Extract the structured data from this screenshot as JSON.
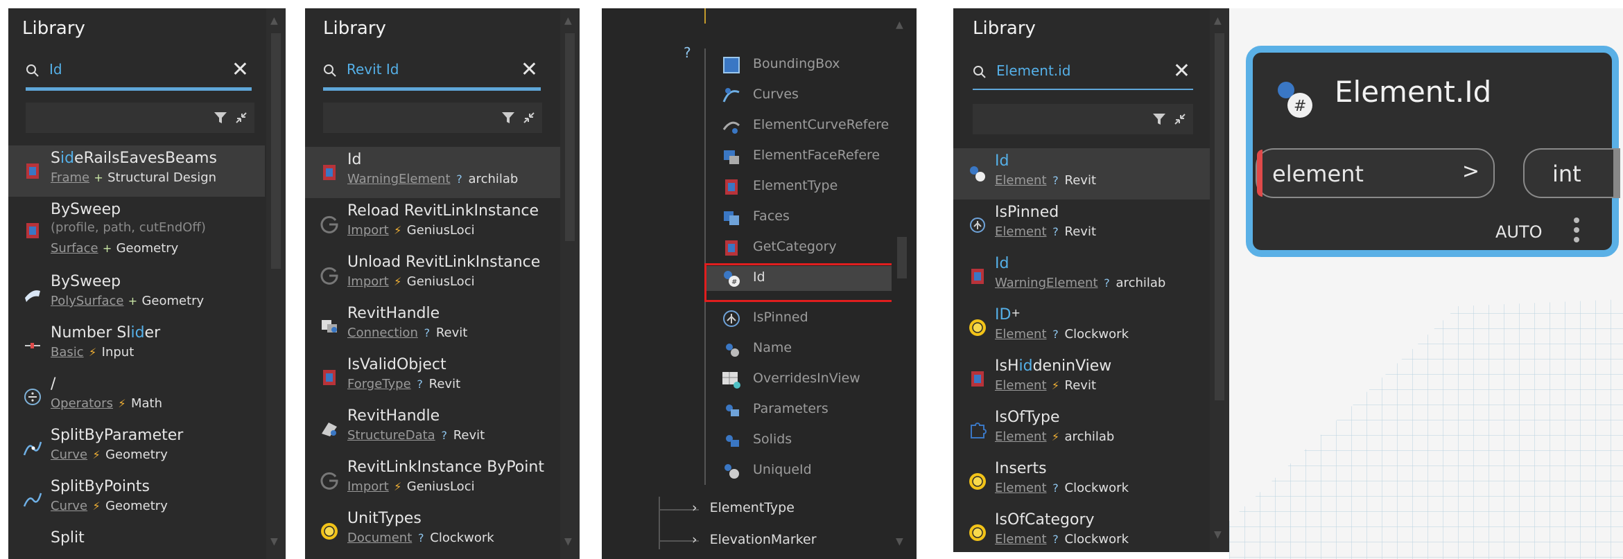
{
  "panel1": {
    "title": "Library",
    "search_value": "Id",
    "items": [
      {
        "name_pre": "S",
        "name_hl": "id",
        "name_post": "eRailsEavesBeams",
        "category": "Frame",
        "sep": "+",
        "package": "Structural Design"
      },
      {
        "name": "BySweep",
        "params": "(profile, path, cutEndOff)",
        "category": "Surface",
        "sep": "+",
        "package": "Geometry"
      },
      {
        "name": "BySweep",
        "category": "PolySurface",
        "sep": "+",
        "package": "Geometry"
      },
      {
        "name_pre": "Number Sl",
        "name_hl": "id",
        "name_post": "er",
        "category": "Basic",
        "sep": "⚡",
        "package": "Input"
      },
      {
        "name": "/",
        "category": "Operators",
        "sep": "⚡",
        "package": "Math"
      },
      {
        "name": "SplitByParameter",
        "category": "Curve",
        "sep": "⚡",
        "package": "Geometry"
      },
      {
        "name": "SplitByPoints",
        "category": "Curve",
        "sep": "⚡",
        "package": "Geometry"
      },
      {
        "name": "Split"
      }
    ]
  },
  "panel2": {
    "title": "Library",
    "search_value": "Revit Id",
    "items": [
      {
        "name": "Id",
        "category": "WarningElement",
        "sep": "?",
        "package": "archilab"
      },
      {
        "name": "Reload RevitLinkInstance",
        "category": "Import",
        "sep": "⚡",
        "package": "GeniusLoci"
      },
      {
        "name": "Unload RevitLinkInstance",
        "category": "Import",
        "sep": "⚡",
        "package": "GeniusLoci"
      },
      {
        "name": "RevitHandle",
        "category": "Connection",
        "sep": "?",
        "package": "Revit"
      },
      {
        "name": "IsValidObject",
        "category": "ForgeType",
        "sep": "?",
        "package": "Revit"
      },
      {
        "name": "RevitHandle",
        "category": "StructureData",
        "sep": "?",
        "package": "Revit"
      },
      {
        "name": "RevitLinkInstance ByPoint",
        "category": "Import",
        "sep": "⚡",
        "package": "GeniusLoci"
      },
      {
        "name": "UnitTypes",
        "category": "Document",
        "sep": "?",
        "package": "Clockwork"
      }
    ]
  },
  "panel3": {
    "question_mark": "?",
    "items": [
      "BoundingBox",
      "Curves",
      "ElementCurveRefere",
      "ElementFaceRefere",
      "ElementType",
      "Faces",
      "GetCategory",
      "Id",
      "IsPinned",
      "Name",
      "OverridesInView",
      "Parameters",
      "Solids",
      "UniqueId"
    ],
    "folders": [
      "ElementType",
      "ElevationMarker"
    ]
  },
  "panel4": {
    "title": "Library",
    "search_value": "Element.id",
    "items": [
      {
        "name_hl": "Id",
        "category": "Element",
        "sep": "?",
        "package": "Revit"
      },
      {
        "name": "IsPinned",
        "category": "Element",
        "sep": "?",
        "package": "Revit"
      },
      {
        "name_hl": "Id",
        "category": "WarningElement",
        "sep": "?",
        "package": "archilab"
      },
      {
        "name_hl": "ID",
        "name_post": "+",
        "category": "Element",
        "sep": "?",
        "package": "Clockwork"
      },
      {
        "name_pre": "IsH",
        "name_hl": "id",
        "name_post": "deninView",
        "category": "Element",
        "sep": "⚡",
        "package": "Revit"
      },
      {
        "name": "IsOfType",
        "category": "Element",
        "sep": "⚡",
        "package": "archilab"
      },
      {
        "name": "Inserts",
        "category": "Element",
        "sep": "?",
        "package": "Clockwork"
      },
      {
        "name": "IsOfCategory",
        "category": "Element",
        "sep": "?",
        "package": "Clockwork"
      }
    ]
  },
  "node": {
    "title": "Element.Id",
    "input_label": "element",
    "input_arrow": ">",
    "output_label": "int",
    "lacing": "AUTO"
  },
  "colors": {
    "accent": "#5ab0e6",
    "panel_bg": "#2a2a2a",
    "highlight": "#55b0e8",
    "selection_outline": "#e01e1e"
  }
}
